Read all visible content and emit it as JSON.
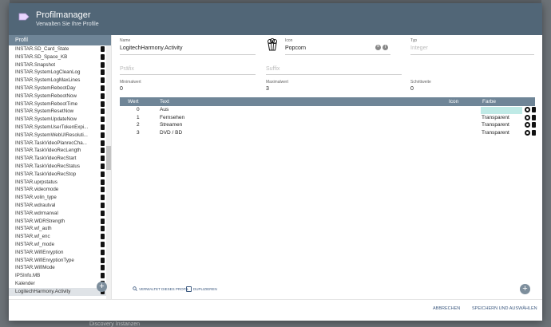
{
  "dialog": {
    "title": "Profilmanager",
    "subtitle": "Verwalten Sie Ihre Profile"
  },
  "sidebar": {
    "header": "Profil",
    "items": [
      "INSTAR.SD_Card_State",
      "INSTAR.SD_Space_KB",
      "INSTAR.Snapshot",
      "INSTAR.SystemLogCleanLog",
      "INSTAR.SystemLogMaxLines",
      "INSTAR.SystemRebootDay",
      "INSTAR.SystemRebootNow",
      "INSTAR.SystemRebootTime",
      "INSTAR.SystemResetNow",
      "INSTAR.SystemUpdateNow",
      "INSTAR.SystemUserTokenExpi...",
      "INSTAR.SystemWebUIResoluti...",
      "INSTAR.TaskVideoPlanrecCha...",
      "INSTAR.TaskVideoRecLength",
      "INSTAR.TaskVideoRecStart",
      "INSTAR.TaskVideoRecStatus",
      "INSTAR.TaskVideoRecStop",
      "INSTAR.uprpstatus",
      "INSTAR.videomode",
      "INSTAR.volin_type",
      "INSTAR.wdrautval",
      "INSTAR.wdrmanval",
      "INSTAR.WDRStrength",
      "INSTAR.wf_auth",
      "INSTAR.wf_enc",
      "INSTAR.wf_mode",
      "INSTAR.WifiEnryption",
      "INSTAR.WifiEnryptionType",
      "INSTAR.WifiMode",
      "IPSInfo.MB",
      "Kalender",
      "LogitechHarmony.Activity"
    ],
    "active_index": 31
  },
  "form": {
    "name_label": "Name",
    "name_value": "LogitechHarmony.Activity",
    "icon_label": "Icon",
    "icon_value": "Popcorn",
    "typ_label": "Typ",
    "typ_value": "Integer",
    "prefix_label": "Präfix",
    "suffix_label": "Suffix",
    "min_label": "Minimalwert",
    "min_value": "0",
    "max_label": "Maximalwert",
    "max_value": "3",
    "step_label": "Schrittweite",
    "step_value": "0"
  },
  "table": {
    "headers": [
      "Wert",
      "Text",
      "Icon",
      "Farbe"
    ],
    "rows": [
      {
        "wert": "0",
        "text": "Aus",
        "farbe": ""
      },
      {
        "wert": "1",
        "text": "Fernsehen",
        "farbe": "Transparent"
      },
      {
        "wert": "2",
        "text": "Streamen",
        "farbe": "Transparent"
      },
      {
        "wert": "3",
        "text": "DVD / BD",
        "farbe": "Transparent"
      }
    ]
  },
  "actions": {
    "used_by": "VERWALTET DIESES PROFIL",
    "duplicate": "DUPLIZIEREN",
    "cancel": "ABBRECHEN",
    "save": "SPEICHERN UND AUSWÄHLEN"
  },
  "background": {
    "bottom_text": "Discovery Instanzen"
  },
  "colors": {
    "header": "#516677",
    "table_header": "#6f8597",
    "accent_swatch": "#bfeae6",
    "link": "#3d5a80"
  }
}
